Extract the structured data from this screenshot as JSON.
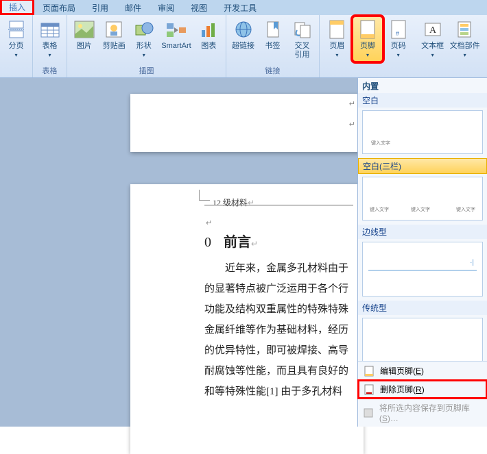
{
  "tabs": {
    "insert": "插入",
    "layout": "页面布局",
    "reference": "引用",
    "mail": "邮件",
    "review": "审阅",
    "view": "视图",
    "dev": "开发工具"
  },
  "ribbon": {
    "groups": {
      "pages": {
        "label_cn": "",
        "btn_page_break": "分页"
      },
      "tables": {
        "label": "表格",
        "btn_table": "表格"
      },
      "illustrations": {
        "label": "插图",
        "btn_picture": "图片",
        "btn_clipart": "剪贴画",
        "btn_shapes": "形状",
        "btn_smartart": "SmartArt",
        "btn_chart": "图表"
      },
      "links": {
        "label": "链接",
        "btn_hyperlink": "超链接",
        "btn_bookmark": "书签",
        "btn_crossref": "交叉\n引用"
      },
      "headerfooter": {
        "btn_header": "页眉",
        "btn_footer": "页脚",
        "btn_pagenum": "页码"
      },
      "text": {
        "btn_textbox": "文本框",
        "btn_parts": "文档部件"
      }
    }
  },
  "document": {
    "header_text": "12 级材料",
    "heading_num": "0",
    "heading_text": "前言",
    "body_lines": [
      "近年来，金属多孔材料由于",
      "的显著特点被广泛运用于各个行",
      "功能及结构双重属性的特殊特殊",
      "金属纤维等作为基础材料，经历",
      "的优异特性，即可被焊接、高导",
      "耐腐蚀等性能，而且具有良好的",
      "和等特殊性能[1]   由于多孔材料"
    ]
  },
  "gallery": {
    "section_builtin": "内置",
    "item_blank": "空白",
    "thumb_placeholder": "键入文字",
    "item_blank3": "空白(三栏)",
    "item_edge": "边线型",
    "item_traditional": "传统型",
    "menu_edit": "编辑页脚",
    "menu_edit_key": "E",
    "menu_delete": "删除页脚",
    "menu_delete_key": "R",
    "menu_save": "将所选内容保存到页脚库",
    "menu_save_key": "S"
  }
}
